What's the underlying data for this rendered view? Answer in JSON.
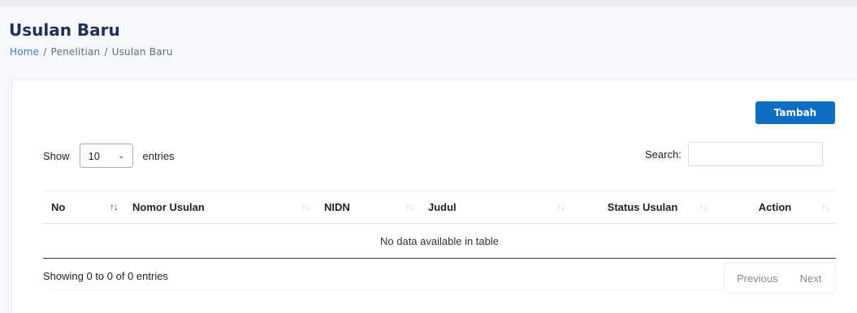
{
  "header": {
    "title": "Usulan Baru",
    "breadcrumb": [
      "Home",
      "Penelitian",
      "Usulan Baru"
    ]
  },
  "toolbar": {
    "add_label": "Tambah"
  },
  "length": {
    "show_label": "Show",
    "selected": "10",
    "entries_label": "entries"
  },
  "search": {
    "label": "Search:",
    "value": "",
    "placeholder": ""
  },
  "table": {
    "columns": [
      "No",
      "Nomor Usulan",
      "NIDN",
      "Judul",
      "Status Usulan",
      "Action"
    ],
    "empty_message": "No data available in table"
  },
  "footer": {
    "info": "Showing 0 to 0 of 0 entries",
    "previous_label": "Previous",
    "next_label": "Next"
  },
  "colors": {
    "accent": "#0d6ec4",
    "title": "#1f2f5c",
    "link": "#3a77c4"
  }
}
